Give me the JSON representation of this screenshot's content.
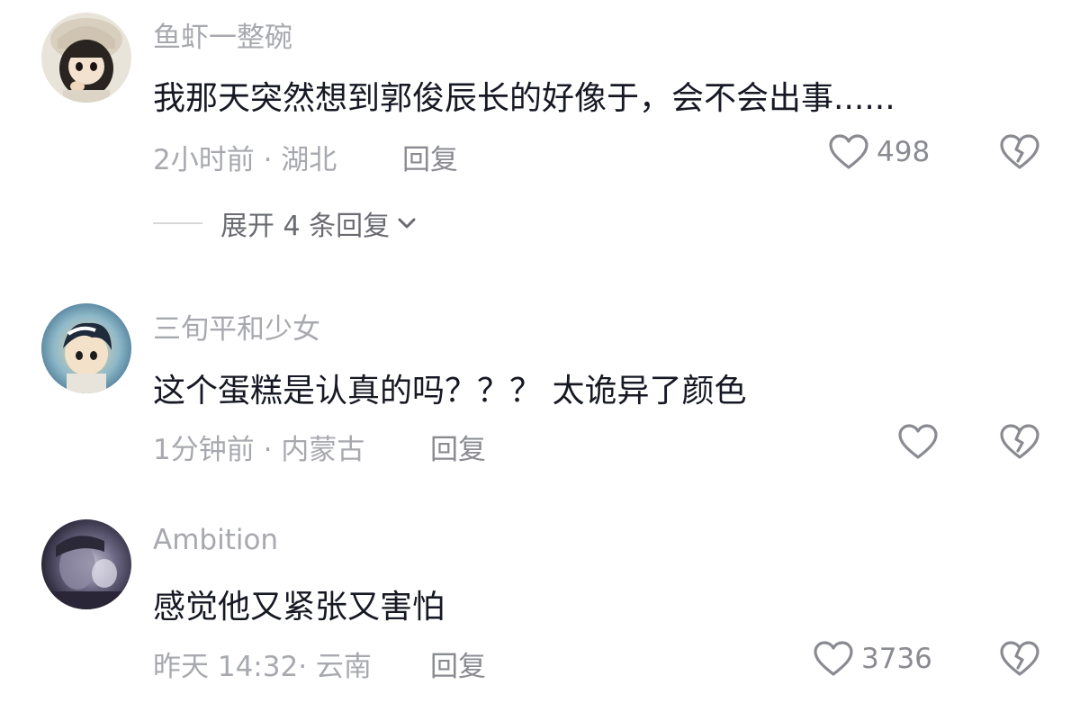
{
  "comments": [
    {
      "username": "鱼虾一整碗",
      "text": "我那天突然想到郭俊辰长的好像于，会不会出事......",
      "meta": "2小时前 · 湖北",
      "reply_label": "回复",
      "likes": "498",
      "avatar_icon": "cartoon-girl-avatar",
      "expand_label": "展开 4 条回复"
    },
    {
      "username": "三旬平和少女",
      "text": "这个蛋糕是认真的吗？？？ 太诡异了颜色",
      "meta": "1分钟前 · 内蒙古",
      "reply_label": "回复",
      "likes": "",
      "avatar_icon": "cartoon-boy-avatar"
    },
    {
      "username": "Ambition",
      "text": "感觉他又紧张又害怕",
      "meta": "昨天 14:32· 云南",
      "reply_label": "回复",
      "likes": "3736",
      "avatar_icon": "dark-photo-avatar"
    }
  ],
  "colors": {
    "username": "#a7a9ae",
    "text": "#161823",
    "meta": "#a7a9ae",
    "icon": "#8a8b91"
  },
  "icons": [
    "heart-icon",
    "broken-heart-icon",
    "chevron-down-icon"
  ]
}
